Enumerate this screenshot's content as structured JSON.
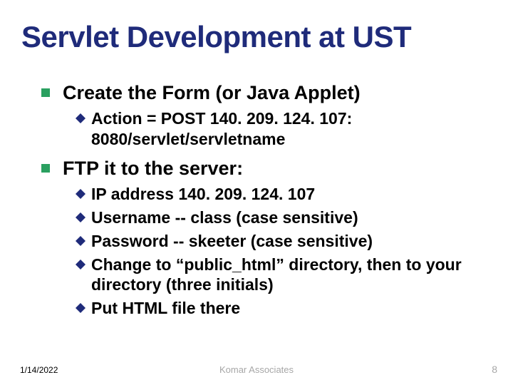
{
  "title": "Servlet Development at UST",
  "bullets": {
    "b0": {
      "text": "Create the Form (or Java Applet)",
      "sub": {
        "s0": {
          "lead": "Action",
          "rest": " = POST 140. 209. 124. 107: 8080/servlet/servletname"
        }
      }
    },
    "b1": {
      "text": "FTP it to the server:",
      "sub": {
        "s0": {
          "lead": "IP",
          "rest": " address 140. 209. 124. 107"
        },
        "s1": {
          "lead": "Username",
          "rest": " -- class (case sensitive)"
        },
        "s2": {
          "lead": "Password",
          "rest": " -- skeeter (case sensitive)"
        },
        "s3": {
          "lead": "Change",
          "rest": " to “public_html” directory, then to your directory (three initials)"
        },
        "s4": {
          "lead": "Put",
          "rest": " HTML file there"
        }
      }
    }
  },
  "footer": {
    "date": "1/14/2022",
    "center": "Komar Associates",
    "page": "8"
  }
}
